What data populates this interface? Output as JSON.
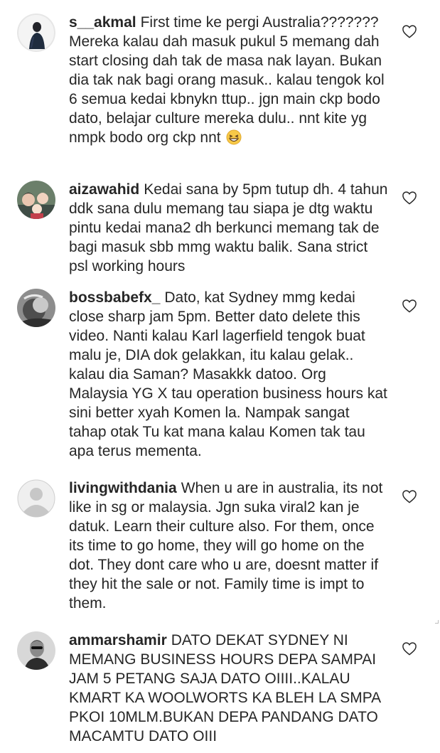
{
  "comments": [
    {
      "username": "s__akmal",
      "text": "First time ke pergi Australia??????? Mereka kalau dah masuk pukul 5 memang dah start closing dah tak de masa nak layan. Bukan dia tak nak bagi orang masuk.. kalau tengok kol 6 semua kedai kbnykn ttup.. jgn main ckp bodo dato, belajar culture mereka dulu.. nnt kite yg nmpk bodo org ckp nnt",
      "emoji": "grinning-squinting-face"
    },
    {
      "username": "aizawahid",
      "text": "Kedai sana by 5pm tutup dh. 4 tahun ddk sana dulu memang tau siapa je dtg waktu pintu kedai mana2 dh berkunci memang tak de bagi masuk sbb mmg waktu balik. Sana strict psl working hours"
    },
    {
      "username": "bossbabefx_",
      "text": "Dato, kat Sydney mmg kedai close sharp jam 5pm. Better dato delete this video. Nanti kalau Karl lagerfield tengok buat malu je, DIA dok gelakkan, itu kalau gelak.. kalau dia Saman? Masakkk datoo. Org Malaysia YG X tau operation business hours kat sini better xyah Komen la. Nampak sangat tahap otak Tu kat mana kalau Komen tak tau apa terus mementa."
    },
    {
      "username": "livingwithdania",
      "text": "When u are in australia, its not like in sg or malaysia. Jgn suka viral2 kan je datuk. Learn their culture also. For them, once its time to go home, they will go home on the dot. They dont care who u are, doesnt matter if they hit the sale or not. Family time is impt to them."
    },
    {
      "username": "ammarshamir",
      "text": "DATO DEKAT SYDNEY NI MEMANG BUSINESS HOURS DEPA SAMPAI JAM 5 PETANG SAJA DATO OIIII..KALAU KMART KA WOOLWORTS KA BLEH LA SMPA PKOI 10MLM.BUKAN DEPA PANDANG DATO MACAMTU DATO OIII"
    }
  ],
  "icons": {
    "like": "heart-outline-icon",
    "emoji": "grinning-squinting-face"
  },
  "colors": {
    "text": "#262626",
    "heart_stroke": "#262626",
    "emoji_yellow": "#f7c948",
    "default_avatar": "#dbdbdb"
  }
}
